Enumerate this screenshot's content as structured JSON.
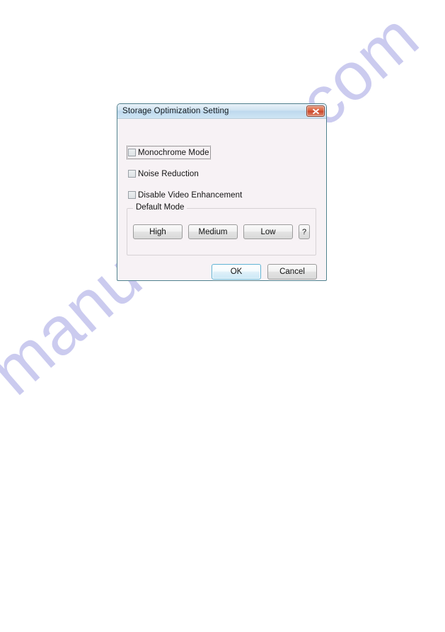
{
  "page": {
    "background_color": "#ffffff",
    "watermark": {
      "text": "manualshive.com",
      "color": "#c9c9ef"
    }
  },
  "dialog": {
    "title": "Storage Optimization Setting",
    "accent_title_color": "#bed9ee",
    "body_color": "#f7f2f5",
    "border_color": "#4f7f8c",
    "close_button": {
      "label": "Close",
      "icon": "close-icon",
      "color": "#c9452a"
    },
    "checkboxes": [
      {
        "label": "Monochrome Mode",
        "checked": false,
        "focused": true
      },
      {
        "label": "Noise Reduction",
        "checked": false,
        "focused": false
      },
      {
        "label": "Disable Video Enhancement",
        "checked": false,
        "focused": false
      }
    ],
    "group": {
      "legend": "Default Mode",
      "buttons": [
        {
          "label": "High"
        },
        {
          "label": "Medium"
        },
        {
          "label": "Low"
        }
      ],
      "help_button": {
        "label": "?",
        "icon": "question-mark-icon"
      }
    },
    "footer": {
      "ok_label": "OK",
      "cancel_label": "Cancel",
      "default_button_color": "#5fb3d4"
    }
  }
}
